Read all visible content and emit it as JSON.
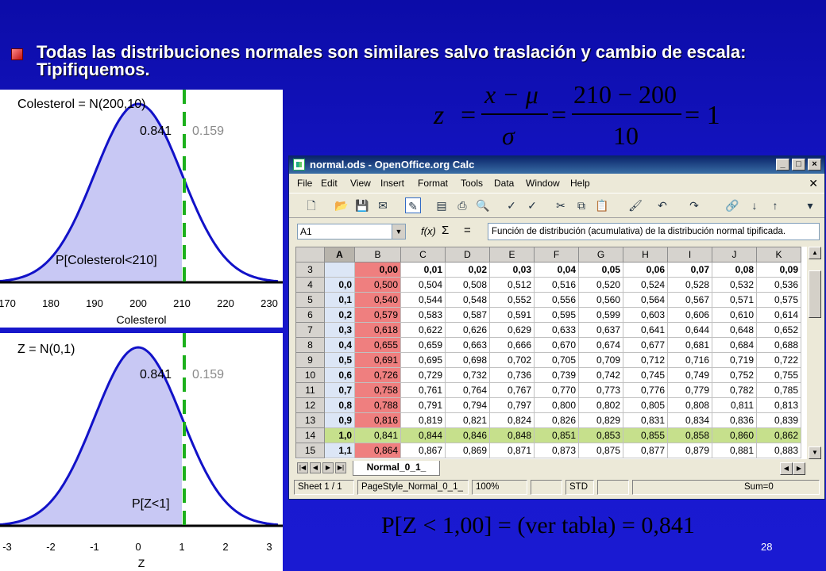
{
  "slide": {
    "bullet_text": "Todas las distribuciones normales son similares salvo traslación y cambio de escala: Tipifiquemos.",
    "page_number": "28",
    "eq1": {
      "z": "z",
      "eq": "=",
      "x_mu": "x − μ",
      "sigma": "σ",
      "num": "210 − 200",
      "den": "10",
      "result": "= 1"
    },
    "eq2": "P[Z < 1,00] = (ver tabla) = 0,841"
  },
  "plot_top": {
    "title": "Colesterol = N(200,10)",
    "left_prob": "0.841",
    "right_prob": "0.159",
    "area_label": "P[Colesterol<210]",
    "ticks": [
      "170",
      "180",
      "190",
      "200",
      "210",
      "220",
      "230"
    ],
    "xlabel": "Colesterol"
  },
  "plot_bottom": {
    "title": "Z = N(0,1)",
    "left_prob": "0.841",
    "right_prob": "0.159",
    "area_label": "P[Z<1]",
    "ticks": [
      "-3",
      "-2",
      "-1",
      "0",
      "1",
      "2",
      "3"
    ],
    "xlabel": "Z"
  },
  "window": {
    "title": "normal.ods - OpenOffice.org Calc",
    "menus": [
      "File",
      "Edit",
      "View",
      "Insert",
      "Format",
      "Tools",
      "Data",
      "Window",
      "Help"
    ],
    "name_box": "A1",
    "fx": "f(x)",
    "sigma": "Σ",
    "equals": "=",
    "formula": "Función de distribución (acumulativa) de la distribución normal tipificada.",
    "columns": [
      "A",
      "B",
      "C",
      "D",
      "E",
      "F",
      "G",
      "H",
      "I",
      "J",
      "K"
    ],
    "rows": [
      {
        "n": "3",
        "a": "",
        "v": [
          "0,00",
          "0,01",
          "0,02",
          "0,03",
          "0,04",
          "0,05",
          "0,06",
          "0,07",
          "0,08",
          "0,09"
        ]
      },
      {
        "n": "4",
        "a": "0,0",
        "v": [
          "0,500",
          "0,504",
          "0,508",
          "0,512",
          "0,516",
          "0,520",
          "0,524",
          "0,528",
          "0,532",
          "0,536"
        ]
      },
      {
        "n": "5",
        "a": "0,1",
        "v": [
          "0,540",
          "0,544",
          "0,548",
          "0,552",
          "0,556",
          "0,560",
          "0,564",
          "0,567",
          "0,571",
          "0,575"
        ]
      },
      {
        "n": "6",
        "a": "0,2",
        "v": [
          "0,579",
          "0,583",
          "0,587",
          "0,591",
          "0,595",
          "0,599",
          "0,603",
          "0,606",
          "0,610",
          "0,614"
        ]
      },
      {
        "n": "7",
        "a": "0,3",
        "v": [
          "0,618",
          "0,622",
          "0,626",
          "0,629",
          "0,633",
          "0,637",
          "0,641",
          "0,644",
          "0,648",
          "0,652"
        ]
      },
      {
        "n": "8",
        "a": "0,4",
        "v": [
          "0,655",
          "0,659",
          "0,663",
          "0,666",
          "0,670",
          "0,674",
          "0,677",
          "0,681",
          "0,684",
          "0,688"
        ]
      },
      {
        "n": "9",
        "a": "0,5",
        "v": [
          "0,691",
          "0,695",
          "0,698",
          "0,702",
          "0,705",
          "0,709",
          "0,712",
          "0,716",
          "0,719",
          "0,722"
        ]
      },
      {
        "n": "10",
        "a": "0,6",
        "v": [
          "0,726",
          "0,729",
          "0,732",
          "0,736",
          "0,739",
          "0,742",
          "0,745",
          "0,749",
          "0,752",
          "0,755"
        ]
      },
      {
        "n": "11",
        "a": "0,7",
        "v": [
          "0,758",
          "0,761",
          "0,764",
          "0,767",
          "0,770",
          "0,773",
          "0,776",
          "0,779",
          "0,782",
          "0,785"
        ]
      },
      {
        "n": "12",
        "a": "0,8",
        "v": [
          "0,788",
          "0,791",
          "0,794",
          "0,797",
          "0,800",
          "0,802",
          "0,805",
          "0,808",
          "0,811",
          "0,813"
        ]
      },
      {
        "n": "13",
        "a": "0,9",
        "v": [
          "0,816",
          "0,819",
          "0,821",
          "0,824",
          "0,826",
          "0,829",
          "0,831",
          "0,834",
          "0,836",
          "0,839"
        ]
      },
      {
        "n": "14",
        "a": "1,0",
        "v": [
          "0,841",
          "0,844",
          "0,846",
          "0,848",
          "0,851",
          "0,853",
          "0,855",
          "0,858",
          "0,860",
          "0,862"
        ]
      },
      {
        "n": "15",
        "a": "1,1",
        "v": [
          "0,864",
          "0,867",
          "0,869",
          "0,871",
          "0,873",
          "0,875",
          "0,877",
          "0,879",
          "0,881",
          "0,883"
        ]
      }
    ],
    "highlight_row": "14",
    "sheet_tab": "Normal_0_1_",
    "status": {
      "sheet": "Sheet 1 / 1",
      "style": "PageStyle_Normal_0_1_",
      "zoom": "100%",
      "mode": "STD",
      "sum": "Sum=0"
    },
    "colors": {
      "title_bar": "#0a246a",
      "col_b_fill": "#ef7f7f",
      "row14_fill": "#c6e08c",
      "header_fill": "#dce6f6"
    }
  }
}
